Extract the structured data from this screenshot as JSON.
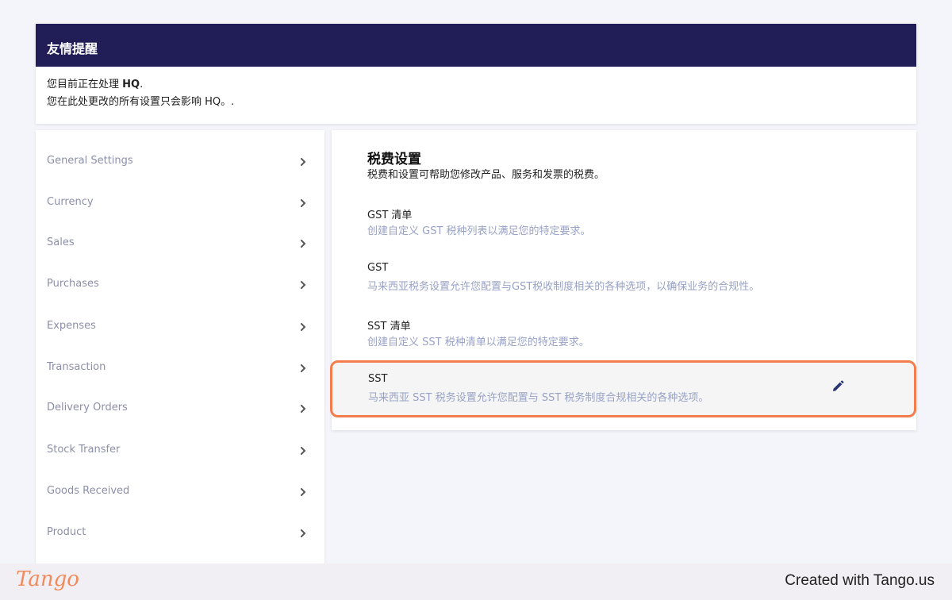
{
  "notice": {
    "title": "友情提醒",
    "line1_prefix": "您目前正在处理 ",
    "line1_bold": "HQ",
    "line1_suffix": ".",
    "line2": "您在此处更改的所有设置只会影响 HQ。."
  },
  "sidebar": {
    "items": [
      {
        "label": "General Settings"
      },
      {
        "label": "Currency"
      },
      {
        "label": "Sales"
      },
      {
        "label": "Purchases"
      },
      {
        "label": "Expenses"
      },
      {
        "label": "Transaction"
      },
      {
        "label": "Delivery Orders"
      },
      {
        "label": "Stock Transfer"
      },
      {
        "label": "Goods Received"
      },
      {
        "label": "Product"
      }
    ]
  },
  "panel": {
    "title": "税费设置",
    "subtitle": "税费和设置可帮助您修改产品、服务和发票的税费。",
    "options": [
      {
        "title": "GST 清单",
        "desc": "创建自定义 GST 税种列表以满足您的特定要求。"
      },
      {
        "title": "GST",
        "desc": "马来西亚税务设置允许您配置与GST税收制度相关的各种选项，以确保业务的合规性。"
      },
      {
        "title": "SST 清单",
        "desc": "创建自定义 SST 税种清单以满足您的特定要求。"
      },
      {
        "title": "SST",
        "desc": "马来西亚 SST 税务设置允许您配置与 SST 税务制度合规相关的各种选项。"
      }
    ]
  },
  "footer": {
    "logo": "Tango",
    "text": "Created with Tango.us"
  },
  "colors": {
    "header_bg": "#201d57",
    "highlight_border": "#f47d4e",
    "muted_text": "#8c8fa8",
    "desc_text": "#98a2c6"
  },
  "icons": [
    "chevron-right-icon",
    "pencil-icon"
  ]
}
